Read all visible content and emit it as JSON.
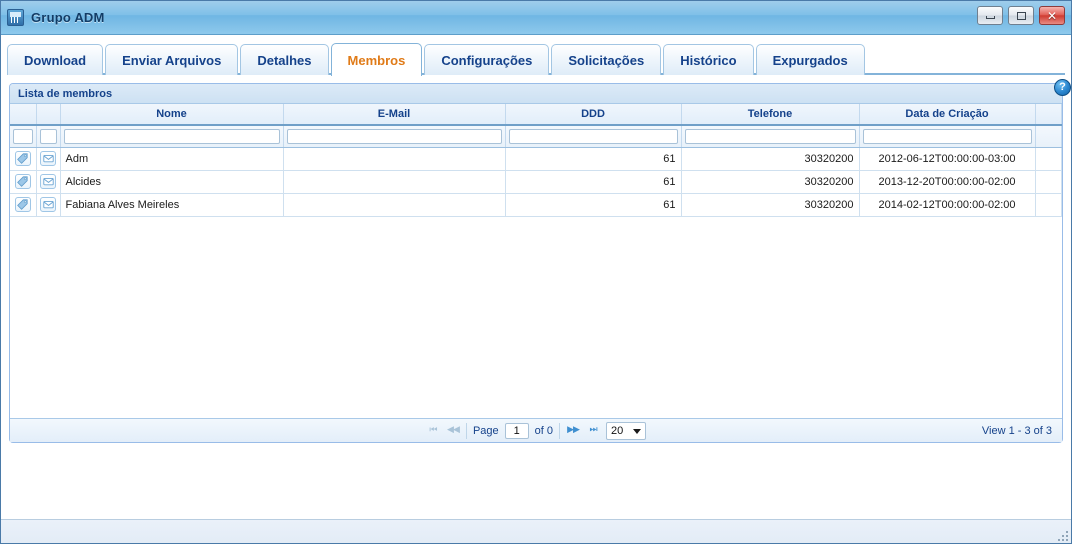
{
  "window": {
    "title": "Grupo ADM",
    "icon": "window-app-icon",
    "buttons": {
      "minimize": "minimize-button",
      "maximize": "maximize-button",
      "close_label": "✕"
    }
  },
  "tabs": [
    {
      "label": "Download",
      "active": false
    },
    {
      "label": "Enviar Arquivos",
      "active": false
    },
    {
      "label": "Detalhes",
      "active": false
    },
    {
      "label": "Membros",
      "active": true
    },
    {
      "label": "Configurações",
      "active": false
    },
    {
      "label": "Solicitações",
      "active": false
    },
    {
      "label": "Histórico",
      "active": false
    },
    {
      "label": "Expurgados",
      "active": false
    }
  ],
  "panel": {
    "title": "Lista de membros",
    "help_label": "?"
  },
  "grid": {
    "columns": [
      {
        "label": "",
        "key": "edit",
        "align": "center"
      },
      {
        "label": "",
        "key": "mail",
        "align": "center"
      },
      {
        "label": "Nome",
        "key": "nome",
        "align": "left"
      },
      {
        "label": "E-Mail",
        "key": "email",
        "align": "left"
      },
      {
        "label": "DDD",
        "key": "ddd",
        "align": "right"
      },
      {
        "label": "Telefone",
        "key": "telefone",
        "align": "right"
      },
      {
        "label": "Data de Criação",
        "key": "data",
        "align": "center"
      },
      {
        "label": "",
        "key": "spacer",
        "align": "center"
      }
    ],
    "filters": {
      "edit": "",
      "mail": "",
      "nome": "",
      "email": "",
      "ddd": "",
      "telefone": "",
      "data": ""
    },
    "rows": [
      {
        "edit_icon": "tag-icon",
        "mail_icon": "envelope-icon",
        "nome": "Adm",
        "email": "",
        "ddd": "61",
        "telefone": "30320200",
        "data": "2012-06-12T00:00:00-03:00"
      },
      {
        "edit_icon": "tag-icon",
        "mail_icon": "envelope-icon",
        "nome": "Alcides",
        "email": "",
        "ddd": "61",
        "telefone": "30320200",
        "data": "2013-12-20T00:00:00-02:00"
      },
      {
        "edit_icon": "tag-icon",
        "mail_icon": "envelope-icon",
        "nome": "Fabiana Alves Meireles",
        "email": "",
        "ddd": "61",
        "telefone": "30320200",
        "data": "2014-02-12T00:00:00-02:00"
      }
    ]
  },
  "pager": {
    "first": "⏮",
    "prev": "◀◀",
    "page_label": "Page",
    "page_value": "1",
    "of_label": "of 0",
    "next": "▶▶",
    "last": "⏭",
    "page_size": "20",
    "view_label": "View 1 - 3 of 3"
  },
  "colors": {
    "accent": "#15428b",
    "active_tab_text": "#e07b18",
    "title_bar": "#7fc0e8",
    "close_button": "#cf3b32"
  }
}
